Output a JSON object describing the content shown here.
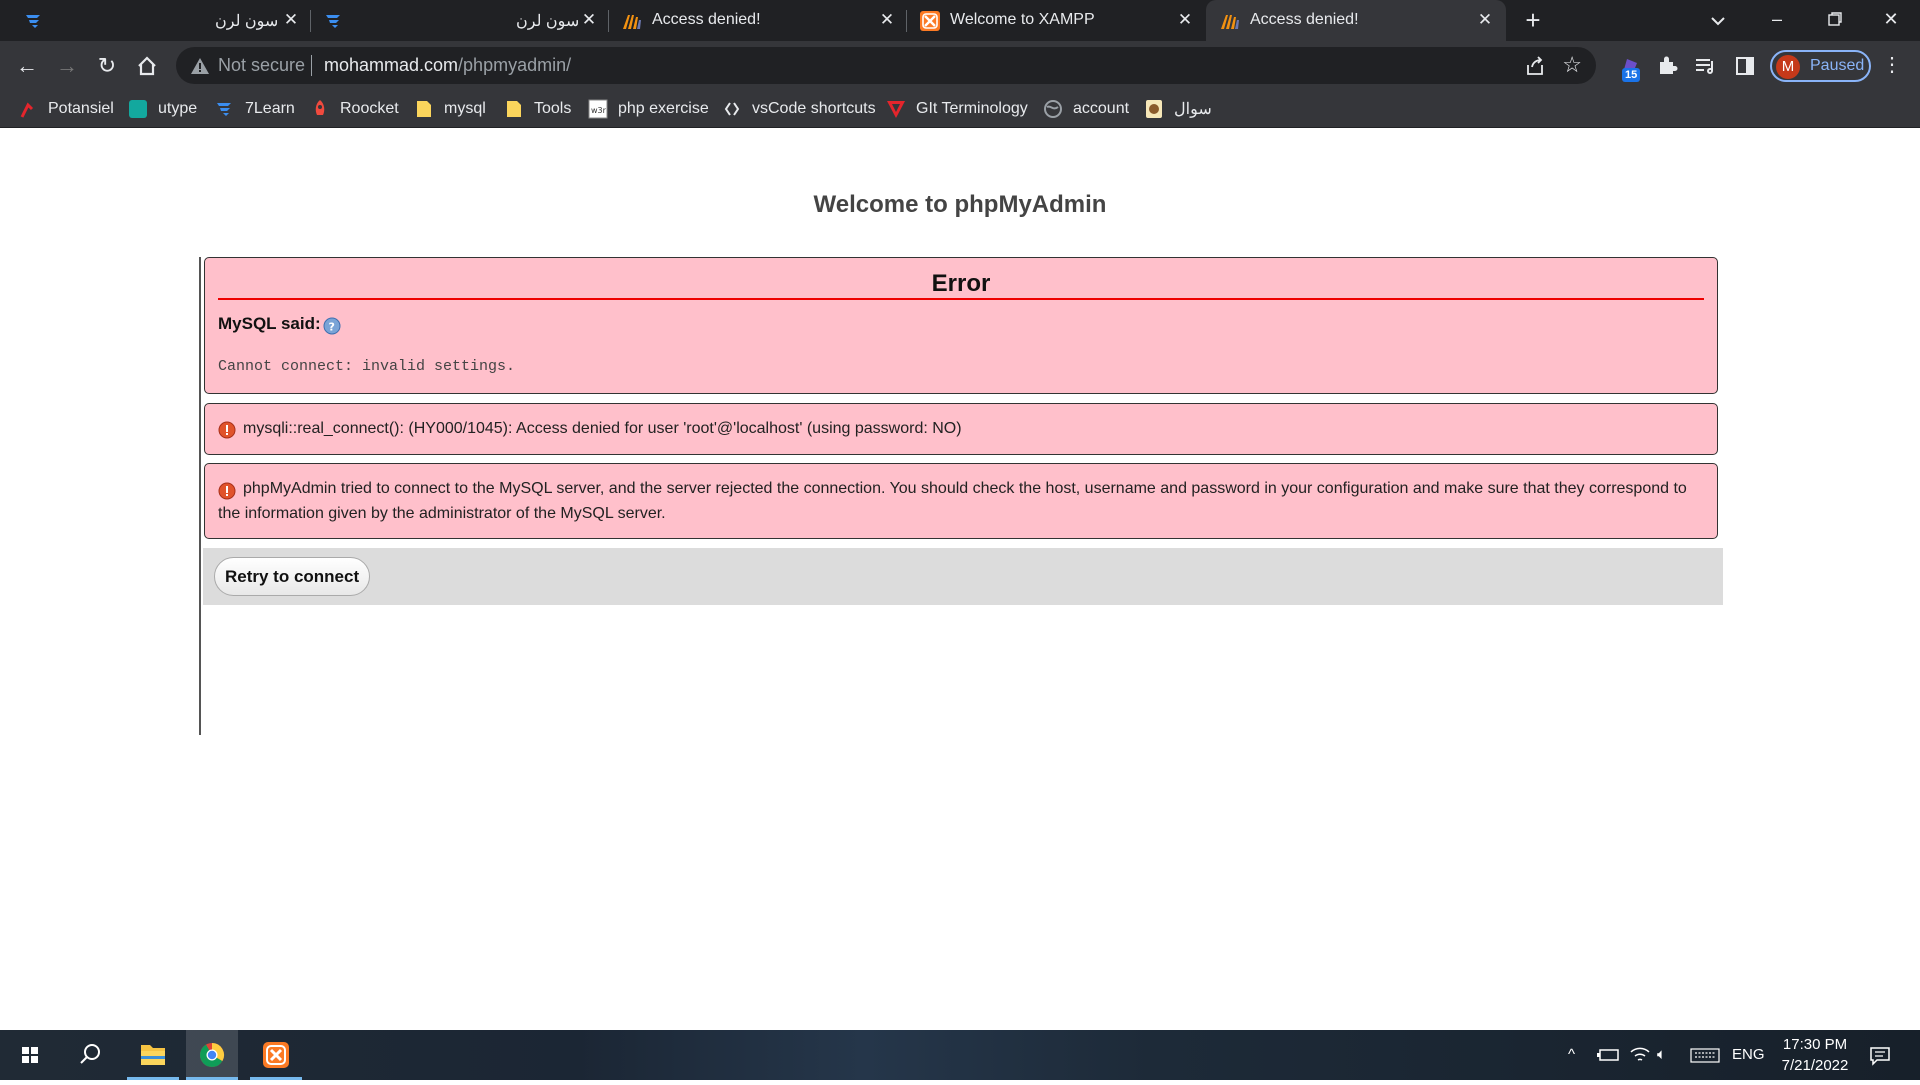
{
  "browser": {
    "tabs": [
      {
        "title": "سون لرن",
        "icon": "sevenlearn-favicon",
        "active": false
      },
      {
        "title": "سون لرن",
        "icon": "sevenlearn-favicon",
        "active": false
      },
      {
        "title": "Access denied!",
        "icon": "phpmyadmin-favicon",
        "active": false
      },
      {
        "title": "Welcome to XAMPP",
        "icon": "xampp-favicon",
        "active": false
      },
      {
        "title": "Access denied!",
        "icon": "phpmyadmin-favicon",
        "active": true
      }
    ],
    "address": {
      "security_label": "Not secure",
      "host": "mohammad.com",
      "path": "/phpmyadmin/"
    },
    "extension_badge": "15",
    "profile": {
      "initial": "M",
      "status": "Paused"
    },
    "bookmarks": [
      {
        "label": "Potansiel",
        "icon": "potansiel-icon"
      },
      {
        "label": "utype",
        "icon": "utype-icon"
      },
      {
        "label": "7Learn",
        "icon": "sevenlearn-icon"
      },
      {
        "label": "Roocket",
        "icon": "roocket-icon"
      },
      {
        "label": "mysql",
        "icon": "folder-icon"
      },
      {
        "label": "Tools",
        "icon": "folder-icon"
      },
      {
        "label": "php exercise",
        "icon": "w3resource-icon"
      },
      {
        "label": "vsCode shortcuts",
        "icon": "code-icon"
      },
      {
        "label": "GIt Terminology",
        "icon": "git-icon"
      },
      {
        "label": "account",
        "icon": "globe-icon"
      },
      {
        "label": "سوال",
        "icon": "question-site-icon"
      }
    ]
  },
  "page": {
    "heading": "Welcome to phpMyAdmin",
    "error": {
      "title": "Error",
      "mysql_said": "MySQL said:",
      "message": "Cannot connect: invalid settings."
    },
    "notices": [
      "mysqli::real_connect(): (HY000/1045): Access denied for user 'root'@'localhost' (using password: NO)",
      "phpMyAdmin tried to connect to the MySQL server, and the server rejected the connection. You should check the host, username and password in your configuration and make sure that they correspond to the information given by the administrator of the MySQL server."
    ],
    "retry_label": "Retry to connect"
  },
  "taskbar": {
    "language": "ENG",
    "time": "17:30 PM",
    "date": "7/21/2022"
  },
  "colors": {
    "error_bg": "#ffc0cb",
    "error_rule": "#ee0000",
    "chrome_dark": "#202124",
    "chrome_toolbar": "#35363a"
  }
}
